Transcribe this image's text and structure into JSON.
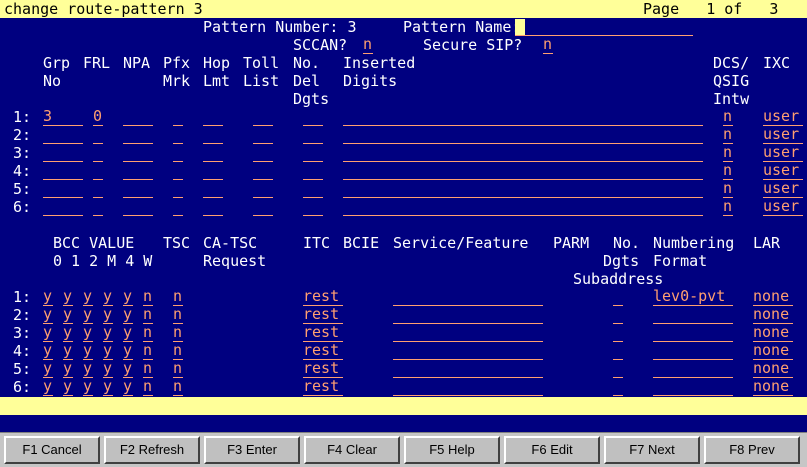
{
  "title_bar": {
    "command": "change route-pattern 3",
    "page": "Page   1 of   3"
  },
  "header": {
    "pattern_number_label": "Pattern Number: 3",
    "pattern_name_label": "Pattern Name:",
    "pattern_name_value": "",
    "sccan_label": "SCCAN?",
    "sccan_value": "n",
    "secure_sip_label": "Secure SIP?",
    "secure_sip_value": "n"
  },
  "trunk_table": {
    "headers": {
      "grp": [
        "Grp",
        "No"
      ],
      "frl": [
        "FRL"
      ],
      "npa": [
        "NPA"
      ],
      "pfx": [
        "Pfx",
        "Mrk"
      ],
      "hop": [
        "Hop",
        "Lmt"
      ],
      "toll": [
        "Toll",
        "List"
      ],
      "no_del": [
        "No.",
        "Del",
        "Dgts"
      ],
      "inserted": [
        "Inserted",
        "Digits"
      ],
      "dcs": [
        "DCS/",
        "QSIG",
        "Intw"
      ],
      "ixc": [
        "IXC"
      ]
    },
    "rows": [
      {
        "num": "1:",
        "grp": "3",
        "frl": "0",
        "npa": "",
        "pfx": "",
        "hop": "",
        "toll": "",
        "del": "",
        "inserted": "",
        "dcs": "n",
        "ixc": "user"
      },
      {
        "num": "2:",
        "grp": "",
        "frl": "",
        "npa": "",
        "pfx": "",
        "hop": "",
        "toll": "",
        "del": "",
        "inserted": "",
        "dcs": "n",
        "ixc": "user"
      },
      {
        "num": "3:",
        "grp": "",
        "frl": "",
        "npa": "",
        "pfx": "",
        "hop": "",
        "toll": "",
        "del": "",
        "inserted": "",
        "dcs": "n",
        "ixc": "user"
      },
      {
        "num": "4:",
        "grp": "",
        "frl": "",
        "npa": "",
        "pfx": "",
        "hop": "",
        "toll": "",
        "del": "",
        "inserted": "",
        "dcs": "n",
        "ixc": "user"
      },
      {
        "num": "5:",
        "grp": "",
        "frl": "",
        "npa": "",
        "pfx": "",
        "hop": "",
        "toll": "",
        "del": "",
        "inserted": "",
        "dcs": "n",
        "ixc": "user"
      },
      {
        "num": "6:",
        "grp": "",
        "frl": "",
        "npa": "",
        "pfx": "",
        "hop": "",
        "toll": "",
        "del": "",
        "inserted": "",
        "dcs": "n",
        "ixc": "user"
      }
    ]
  },
  "bcc_table": {
    "headers": {
      "bcc_value": [
        "BCC VALUE",
        "0 1 2 M 4 W"
      ],
      "tsc": [
        "TSC"
      ],
      "ca_tsc": [
        "CA-TSC",
        "Request"
      ],
      "itc": [
        "ITC"
      ],
      "bcie": [
        "BCIE"
      ],
      "service": [
        "Service/Feature"
      ],
      "parm": [
        "PARM"
      ],
      "no_dgts": [
        "No.",
        "Dgts",
        "Subaddress"
      ],
      "numbering": [
        "Numbering",
        "Format"
      ],
      "lar": [
        "LAR"
      ]
    },
    "rows": [
      {
        "num": "1:",
        "bcc": [
          "y",
          "y",
          "y",
          "y",
          "y",
          "n"
        ],
        "tsc": "n",
        "ca_tsc": "",
        "itc": "rest",
        "bcie": "",
        "service": "",
        "no_dgts": "",
        "numbering": "lev0-pvt",
        "lar": "none"
      },
      {
        "num": "2:",
        "bcc": [
          "y",
          "y",
          "y",
          "y",
          "y",
          "n"
        ],
        "tsc": "n",
        "ca_tsc": "",
        "itc": "rest",
        "bcie": "",
        "service": "",
        "no_dgts": "",
        "numbering": "",
        "lar": "none"
      },
      {
        "num": "3:",
        "bcc": [
          "y",
          "y",
          "y",
          "y",
          "y",
          "n"
        ],
        "tsc": "n",
        "ca_tsc": "",
        "itc": "rest",
        "bcie": "",
        "service": "",
        "no_dgts": "",
        "numbering": "",
        "lar": "none"
      },
      {
        "num": "4:",
        "bcc": [
          "y",
          "y",
          "y",
          "y",
          "y",
          "n"
        ],
        "tsc": "n",
        "ca_tsc": "",
        "itc": "rest",
        "bcie": "",
        "service": "",
        "no_dgts": "",
        "numbering": "",
        "lar": "none"
      },
      {
        "num": "5:",
        "bcc": [
          "y",
          "y",
          "y",
          "y",
          "y",
          "n"
        ],
        "tsc": "n",
        "ca_tsc": "",
        "itc": "rest",
        "bcie": "",
        "service": "",
        "no_dgts": "",
        "numbering": "",
        "lar": "none"
      },
      {
        "num": "6:",
        "bcc": [
          "y",
          "y",
          "y",
          "y",
          "y",
          "n"
        ],
        "tsc": "n",
        "ca_tsc": "",
        "itc": "rest",
        "bcie": "",
        "service": "",
        "no_dgts": "",
        "numbering": "",
        "lar": "none"
      }
    ]
  },
  "status_bar": {
    "message": ""
  },
  "function_keys": [
    {
      "label": "F1 Cancel"
    },
    {
      "label": "F2 Refresh"
    },
    {
      "label": "F3 Enter"
    },
    {
      "label": "F4 Clear"
    },
    {
      "label": "F5 Help"
    },
    {
      "label": "F6 Edit"
    },
    {
      "label": "F7 Next"
    },
    {
      "label": "F8 Prev"
    }
  ],
  "colors": {
    "screen_bg": "#000080",
    "bar_bg": "#ffff99",
    "field": "#ff9f70",
    "label": "#ffffff"
  }
}
